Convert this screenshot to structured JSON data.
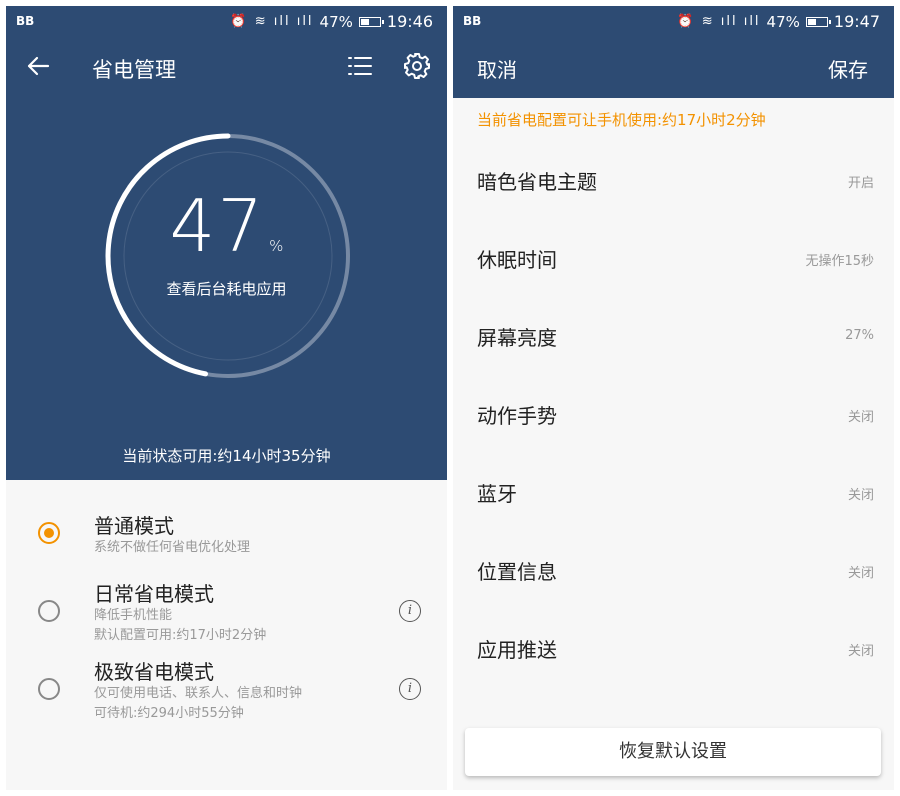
{
  "colors": {
    "primary": "#2d4b73",
    "accent": "#f39200",
    "background": "#f7f7f7"
  },
  "left": {
    "statusbar": {
      "carrier_icon": "BB",
      "signal": "47%",
      "time": "19:46",
      "battery_level": 0.47
    },
    "appbar": {
      "title": "省电管理",
      "back_icon": "arrow-left-icon",
      "list_icon": "list-icon",
      "settings_icon": "gear-icon"
    },
    "battery": {
      "percent": "47",
      "unit": "%",
      "level": 0.47,
      "caption": "查看后台耗电应用"
    },
    "status_line": "当前状态可用:约14小时35分钟",
    "modes": [
      {
        "title": "普通模式",
        "lines": [
          "系统不做任何省电优化处理"
        ],
        "selected": true,
        "info": false
      },
      {
        "title": "日常省电模式",
        "lines": [
          "降低手机性能",
          "默认配置可用:约17小时2分钟"
        ],
        "selected": false,
        "info": true
      },
      {
        "title": "极致省电模式",
        "lines": [
          "仅可使用电话、联系人、信息和时钟",
          "可待机:约294小时55分钟"
        ],
        "selected": false,
        "info": true
      }
    ]
  },
  "right": {
    "statusbar": {
      "carrier_icon": "BB",
      "signal": "47%",
      "time": "19:47",
      "battery_level": 0.47
    },
    "appbar": {
      "cancel": "取消",
      "save": "保存"
    },
    "notice": "当前省电配置可让手机使用:约17小时2分钟",
    "settings": [
      {
        "label": "暗色省电主题",
        "value": "开启"
      },
      {
        "label": "休眠时间",
        "value": "无操作15秒"
      },
      {
        "label": "屏幕亮度",
        "value": "27%"
      },
      {
        "label": "动作手势",
        "value": "关闭"
      },
      {
        "label": "蓝牙",
        "value": "关闭"
      },
      {
        "label": "位置信息",
        "value": "关闭"
      },
      {
        "label": "应用推送",
        "value": "关闭"
      }
    ],
    "restore_button": "恢复默认设置"
  }
}
